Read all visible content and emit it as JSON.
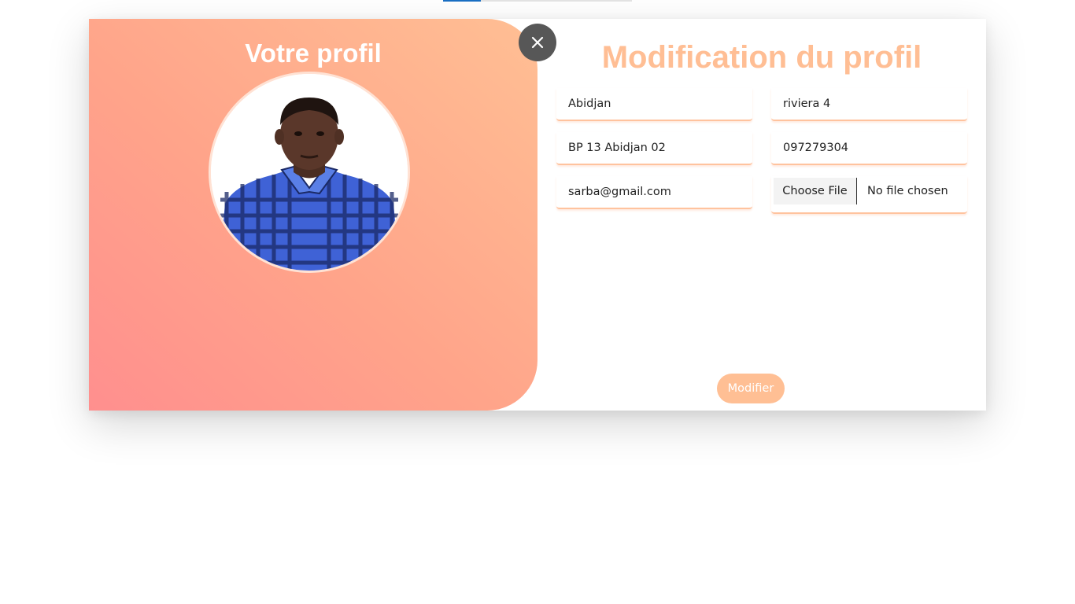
{
  "left_panel": {
    "title": "Votre profil",
    "avatar_icon": "profile-photo"
  },
  "right_panel": {
    "title": "Modification du profil"
  },
  "form": {
    "fields": [
      {
        "name": "city",
        "value": "Abidjan"
      },
      {
        "name": "district",
        "value": "riviera 4"
      },
      {
        "name": "postal",
        "value": "BP 13 Abidjan 02"
      },
      {
        "name": "phone",
        "value": "097279304"
      },
      {
        "name": "email",
        "value": "sarba@gmail.com"
      }
    ],
    "file": {
      "button_label": "Choose File",
      "status": "No file chosen"
    },
    "submit_label": "Modifier"
  },
  "controls": {
    "close_icon": "close-icon"
  },
  "colors": {
    "accent": "#ffbf94",
    "gradient_start": "#ff8f8e",
    "gradient_end": "#ffbf94",
    "close_button": "#575757"
  }
}
